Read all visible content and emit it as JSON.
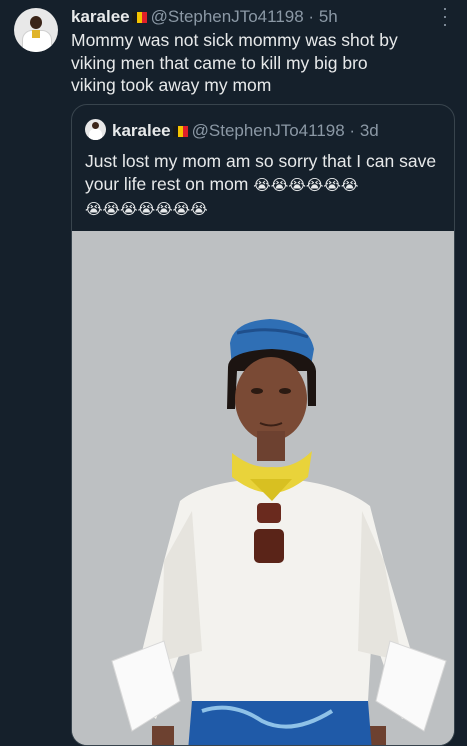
{
  "tweet": {
    "name": "karalee",
    "handle": "@StephenJTo41198",
    "sep": "·",
    "time": "5h",
    "text": "Mommy was not sick mommy was shot by\nviking men that came to kill my big bro\n viking took away my mom"
  },
  "quoted": {
    "name": "karalee",
    "handle": "@StephenJTo41198",
    "sep": "·",
    "time": "3d",
    "text": "Just lost my mom am so sorry that I can save your life rest on mom",
    "emoji_row1": "😭😭😭😭😭😭",
    "emoji_row2": "😭😭😭😭😭😭😭"
  },
  "icons": {
    "more": "more-options-icon",
    "flag": "flag-icon"
  },
  "colors": {
    "background": "#15202b",
    "text": "#e7e9ea",
    "muted": "#8b98a5",
    "border": "#38444d",
    "photo_bg": "#bcbfc1"
  }
}
